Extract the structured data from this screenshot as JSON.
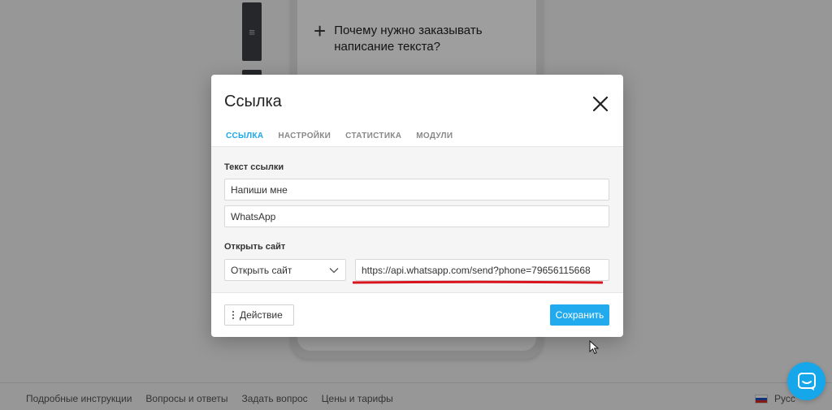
{
  "background": {
    "faq_question": "Почему нужно заказывать написание текста?",
    "footer_links": [
      "Подробные инструкции",
      "Вопросы и ответы",
      "Задать вопрос",
      "Цены и тарифы"
    ],
    "language": "Русс"
  },
  "modal": {
    "title": "Ссылка",
    "tabs": [
      {
        "label": "ССЫЛКА",
        "active": true
      },
      {
        "label": "НАСТРОЙКИ",
        "active": false
      },
      {
        "label": "СТАТИСТИКА",
        "active": false
      },
      {
        "label": "МОДУЛИ",
        "active": false
      }
    ],
    "link_text_label": "Текст ссылки",
    "link_text_value": "Напиши мне",
    "link_subtext_value": "WhatsApp",
    "open_site_label": "Открыть сайт",
    "open_site_select": "Открыть сайт",
    "url_value": "https://api.whatsapp.com/send?phone=79656115668",
    "action_button": "Действие",
    "save_button": "Сохранить"
  },
  "colors": {
    "accent": "#1aa8ea",
    "save_button": "#22aaef",
    "highlight_underline": "#d9141e"
  }
}
